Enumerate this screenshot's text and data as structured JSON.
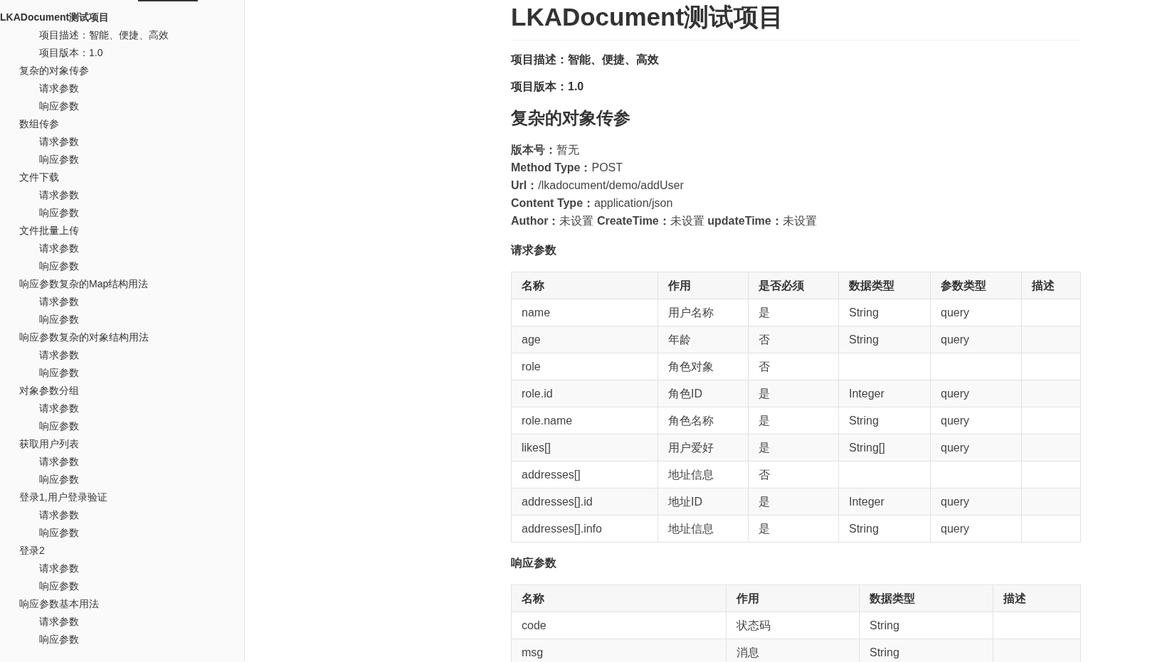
{
  "sidebar": {
    "items": [
      {
        "kind": "title",
        "label": "LKADocument测试项目",
        "children": [
          {
            "label": "项目描述：智能、便捷、高效"
          },
          {
            "label": "项目版本：1.0"
          }
        ]
      },
      {
        "kind": "section",
        "label": "复杂的对象传参",
        "children": [
          {
            "label": "请求参数"
          },
          {
            "label": "响应参数"
          }
        ]
      },
      {
        "kind": "section",
        "label": "数组传参",
        "children": [
          {
            "label": "请求参数"
          },
          {
            "label": "响应参数"
          }
        ]
      },
      {
        "kind": "section",
        "label": "文件下载",
        "children": [
          {
            "label": "请求参数"
          },
          {
            "label": "响应参数"
          }
        ]
      },
      {
        "kind": "section",
        "label": "文件批量上传",
        "children": [
          {
            "label": "请求参数"
          },
          {
            "label": "响应参数"
          }
        ]
      },
      {
        "kind": "section",
        "label": "响应参数复杂的Map结构用法",
        "children": [
          {
            "label": "请求参数"
          },
          {
            "label": "响应参数"
          }
        ]
      },
      {
        "kind": "section",
        "label": "响应参数复杂的对象结构用法",
        "children": [
          {
            "label": "请求参数"
          },
          {
            "label": "响应参数"
          }
        ]
      },
      {
        "kind": "section",
        "label": "对象参数分组",
        "children": [
          {
            "label": "请求参数"
          },
          {
            "label": "响应参数"
          }
        ]
      },
      {
        "kind": "section",
        "label": "获取用户列表",
        "children": [
          {
            "label": "请求参数"
          },
          {
            "label": "响应参数"
          }
        ]
      },
      {
        "kind": "section",
        "label": "登录1,用户登录验证",
        "children": [
          {
            "label": "请求参数"
          },
          {
            "label": "响应参数"
          }
        ]
      },
      {
        "kind": "section",
        "label": "登录2",
        "children": [
          {
            "label": "请求参数"
          },
          {
            "label": "响应参数"
          }
        ]
      },
      {
        "kind": "section",
        "label": "响应参数基本用法",
        "children": [
          {
            "label": "请求参数"
          },
          {
            "label": "响应参数"
          }
        ]
      }
    ]
  },
  "document": {
    "title": "LKADocument测试项目",
    "summary": [
      "项目描述：智能、便捷、高效",
      "项目版本：1.0"
    ],
    "sections": [
      {
        "title": "复杂的对象传参",
        "info": [
          "**版本号：**暂无",
          "**Method Type：**POST",
          "**Url：**/lkadocument/demo/addUser",
          "**Content Type：**application/json",
          "**Author：**未设置 **CreateTime：**未设置 **updateTime：**未设置"
        ],
        "tables": [
          {
            "heading": "请求参数",
            "columns": [
              "名称",
              "作用",
              "是否必须",
              "数据类型",
              "参数类型",
              "描述"
            ],
            "rows": [
              [
                "name",
                "用户名称",
                "是",
                "String",
                "query"
              ],
              [
                "age",
                "年龄",
                "否",
                "String",
                "query"
              ],
              [
                "role",
                "角色对象",
                "否"
              ],
              [
                "role.id",
                "角色ID",
                "是",
                "Integer",
                "query"
              ],
              [
                "role.name",
                "角色名称",
                "是",
                "String",
                "query"
              ],
              [
                "likes[]",
                "用户爱好",
                "是",
                "String[]",
                "query"
              ],
              [
                "addresses[]",
                "地址信息",
                "否"
              ],
              [
                "addresses[].id",
                "地址ID",
                "是",
                "Integer",
                "query"
              ],
              [
                "addresses[].info",
                "地址信息",
                "是",
                "String",
                "query"
              ]
            ]
          },
          {
            "heading": "响应参数",
            "columns": [
              "名称",
              "作用",
              "数据类型",
              "描述"
            ],
            "rows": [
              [
                "code",
                "状态码",
                "String"
              ],
              [
                "msg",
                "消息",
                "String"
              ]
            ]
          }
        ]
      }
    ]
  }
}
